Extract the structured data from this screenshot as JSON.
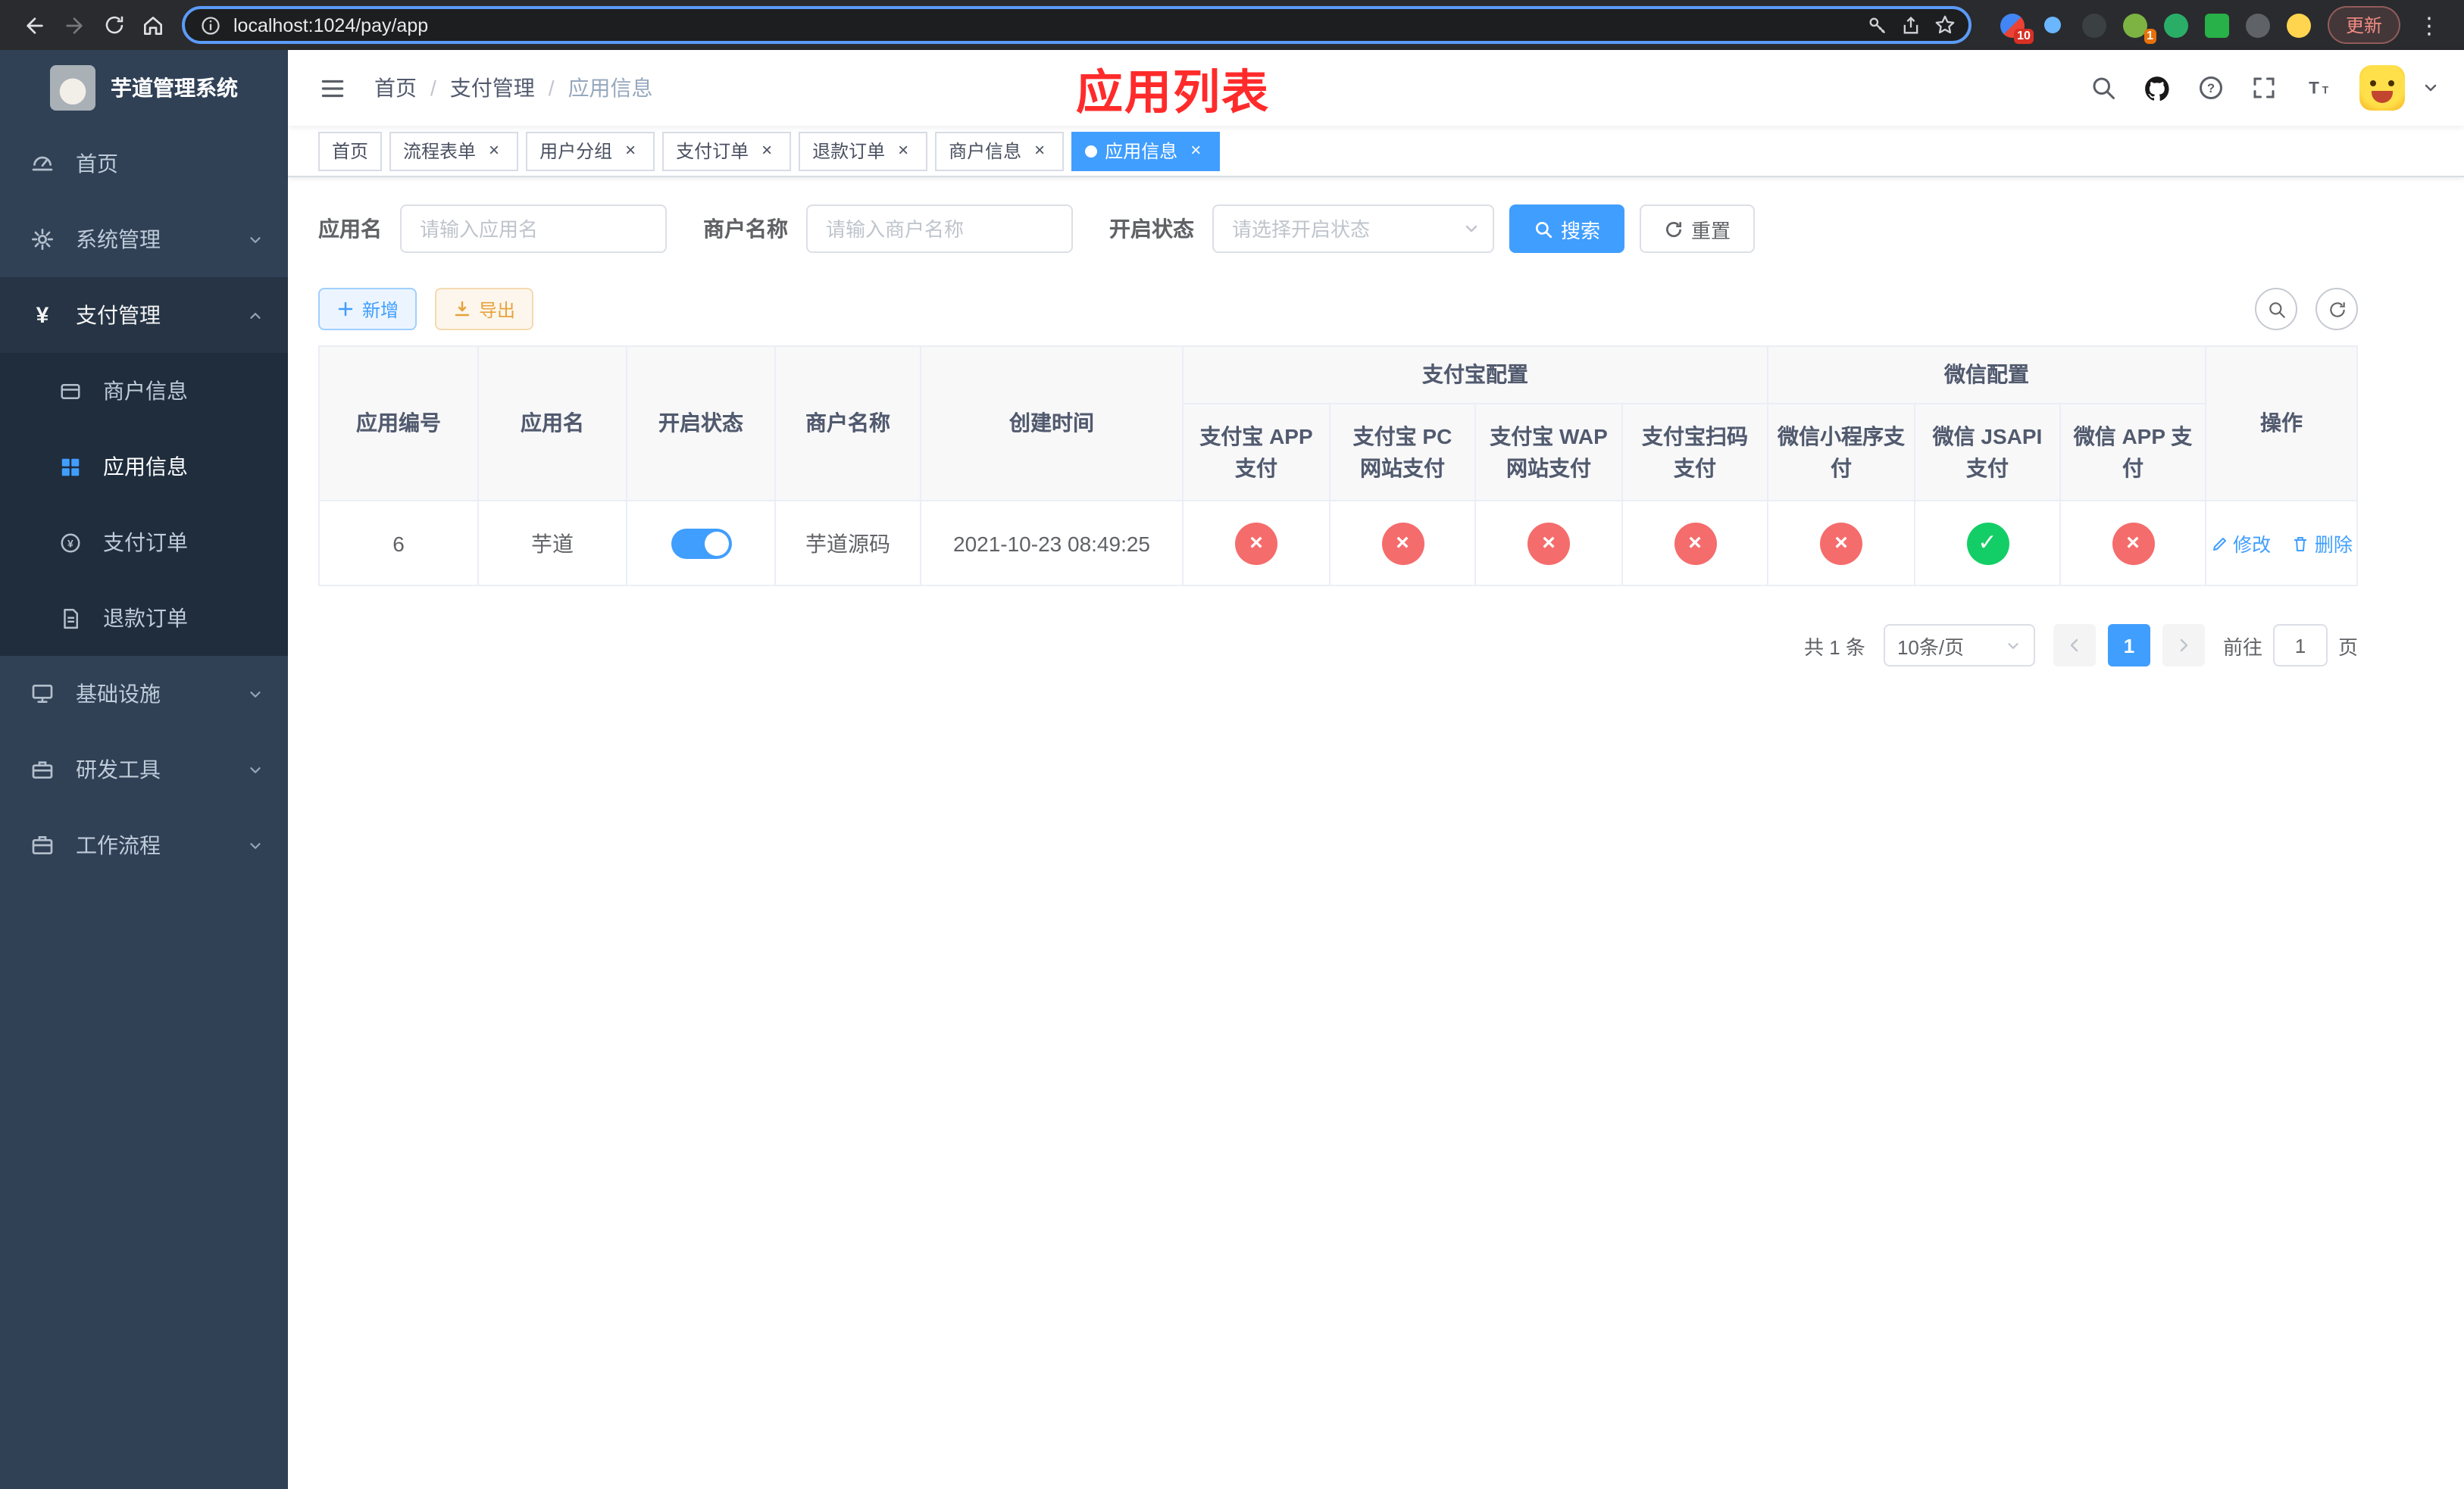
{
  "browser": {
    "url": "localhost:1024/pay/app",
    "update_button": "更新",
    "ext_badge_red": "10",
    "ext_badge_orange": "1"
  },
  "icons": {
    "close": "×",
    "dots_menu": "⋮",
    "yen": "¥",
    "check": "✓",
    "cross": "×",
    "question": "?",
    "text_big": "T",
    "text_small": "T"
  },
  "colors": {
    "primary": "#409eff",
    "success": "#13ce66",
    "danger": "#f56c6c",
    "warning": "#e6a23c",
    "annotation_red": "#ff2b2b",
    "sidebar_bg": "#304156",
    "submenu_bg": "#1f2d3d"
  },
  "sidebar": {
    "title": "芋道管理系统",
    "home": "首页",
    "system": "系统管理",
    "payment": "支付管理",
    "merchant_info": "商户信息",
    "app_info": "应用信息",
    "pay_order": "支付订单",
    "refund_order": "退款订单",
    "infra": "基础设施",
    "dev_tools": "研发工具",
    "workflow": "工作流程"
  },
  "header": {
    "breadcrumb": [
      "首页",
      "支付管理",
      "应用信息"
    ],
    "annotation": "应用列表"
  },
  "tabs": [
    "首页",
    "流程表单",
    "用户分组",
    "支付订单",
    "退款订单",
    "商户信息",
    "应用信息"
  ],
  "filters": {
    "app_name_label": "应用名",
    "app_name_placeholder": "请输入应用名",
    "merchant_label": "商户名称",
    "merchant_placeholder": "请输入商户名称",
    "status_label": "开启状态",
    "status_placeholder": "请选择开启状态",
    "search_label": "搜索",
    "reset_label": "重置"
  },
  "toolbar": {
    "add_label": "新增",
    "export_label": "导出"
  },
  "table": {
    "col_app_id": "应用编号",
    "col_app_name": "应用名",
    "col_status": "开启状态",
    "col_merchant": "商户名称",
    "col_created": "创建时间",
    "group_alipay": "支付宝配置",
    "group_wechat": "微信配置",
    "col_alipay_app": "支付宝 APP 支付",
    "col_alipay_pc": "支付宝 PC 网站支付",
    "col_alipay_wap": "支付宝 WAP 网站支付",
    "col_alipay_qr": "支付宝扫码支付",
    "col_wx_mini": "微信小程序支付",
    "col_wx_jsapi": "微信 JSAPI 支付",
    "col_wx_app": "微信 APP 支付",
    "col_actions": "操作",
    "rows": [
      {
        "app_id": "6",
        "app_name": "芋道",
        "enabled": true,
        "merchant": "芋道源码",
        "created": "2021-10-23 08:49:25",
        "statuses": [
          false,
          false,
          false,
          false,
          false,
          true,
          false
        ],
        "edit": "修改",
        "delete": "删除"
      }
    ]
  },
  "pagination": {
    "total": "共 1 条",
    "page_size": "10条/页",
    "page": "1",
    "goto": "前往",
    "goto_value": "1",
    "unit": "页"
  }
}
